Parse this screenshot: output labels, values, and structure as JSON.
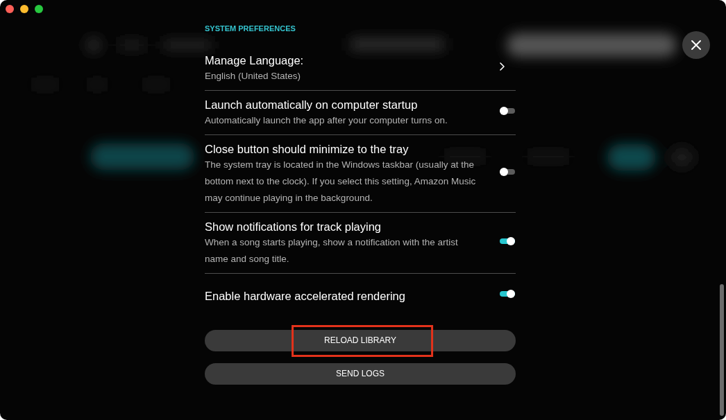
{
  "section_title": "SYSTEM PREFERENCES",
  "settings": [
    {
      "kind": "link",
      "title": "Manage Language:",
      "value": "English (United States)"
    },
    {
      "kind": "toggle",
      "title": "Launch automatically on computer startup",
      "description": "Automatically launch the app after your computer turns on.",
      "on": false
    },
    {
      "kind": "toggle",
      "title": "Close button should minimize to the tray",
      "description": "The system tray is located in the Windows taskbar (usually at the bottom next to the clock). If you select this setting, Amazon Music may continue playing in the background.",
      "on": false
    },
    {
      "kind": "toggle",
      "title": "Show notifications for track playing",
      "description": "When a song starts playing, show a notification with the artist name and song title.",
      "on": true
    },
    {
      "kind": "toggle",
      "title": "Enable hardware accelerated rendering",
      "on": true
    }
  ],
  "buttons": [
    {
      "label": "RELOAD LIBRARY",
      "highlighted": true
    },
    {
      "label": "SEND LOGS",
      "highlighted": false
    }
  ]
}
